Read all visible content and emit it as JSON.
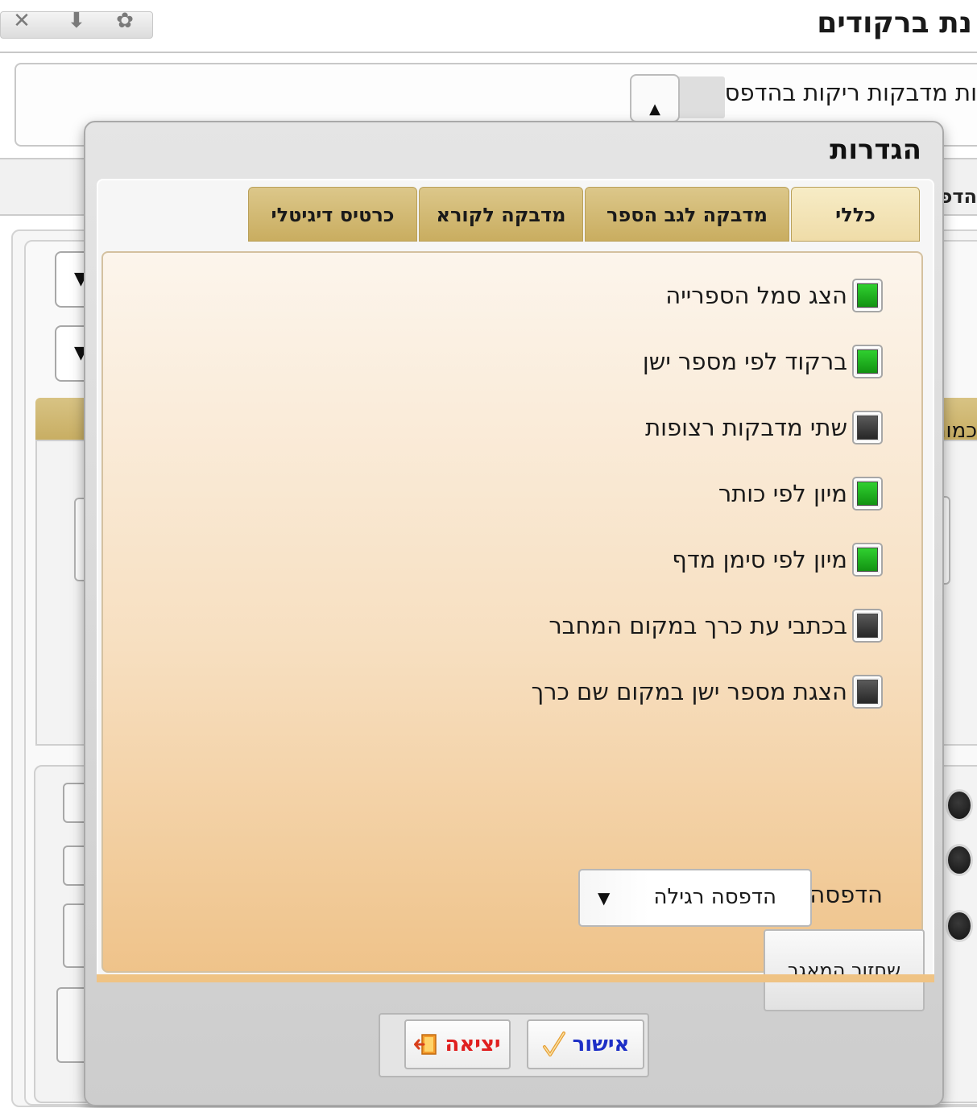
{
  "background_window": {
    "title": "נת ברקודים",
    "empty_labels_text": "ות מדבקות ריקות בהדפסה",
    "tab_fragment": "הדפ",
    "gold_text": "כמור",
    "combo_arrow": "▼",
    "spin_arrows": "▲\n▼"
  },
  "dialog": {
    "title": "הגדרות",
    "tabs": [
      {
        "label": "כללי",
        "active": true
      },
      {
        "label": "מדבקה לגב הספר",
        "active": false
      },
      {
        "label": "מדבקה לקורא",
        "active": false
      },
      {
        "label": "כרטיס דיגיטלי",
        "active": false
      }
    ],
    "options": [
      {
        "label": "הצג סמל הספרייה",
        "checked": true
      },
      {
        "label": "ברקוד לפי מספר ישן",
        "checked": true
      },
      {
        "label": "שתי מדבקות רצופות",
        "checked": false
      },
      {
        "label": "מיון לפי כותר",
        "checked": true
      },
      {
        "label": "מיון לפי סימן מדף",
        "checked": true
      },
      {
        "label": "בכתבי עת כרך במקום המחבר",
        "checked": false
      },
      {
        "label": "הצגת מספר ישן במקום שם כרך",
        "checked": false
      }
    ],
    "print_by": {
      "label": "הדפסה לפי",
      "value": "הדפסה רגילה",
      "arrow": "▼"
    },
    "restore_button": "שחזור המאגר",
    "ok_button": "אישור",
    "exit_button": "יציאה"
  },
  "colors": {
    "checked": "#1aa81a",
    "unchecked": "#333333",
    "tab_gold": "#d4bb74",
    "ok_text": "#1d2fc6",
    "exit_text": "#e02020"
  }
}
